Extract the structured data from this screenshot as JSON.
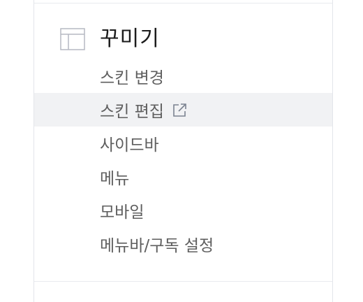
{
  "section": {
    "title": "꾸미기",
    "icon": "layout-icon"
  },
  "menu": {
    "items": [
      {
        "label": "스킨 변경",
        "active": false
      },
      {
        "label": "스킨 편집",
        "active": true,
        "icon": "external-link-icon"
      },
      {
        "label": "사이드바",
        "active": false
      },
      {
        "label": "메뉴",
        "active": false
      },
      {
        "label": "모바일",
        "active": false
      },
      {
        "label": "메뉴바/구독 설정",
        "active": false
      }
    ]
  },
  "colors": {
    "active_background": "#f1f2f4",
    "title_text": "#1c1c1c",
    "item_text": "#5e5e5e",
    "icon_stroke": "#b5b9c2"
  }
}
